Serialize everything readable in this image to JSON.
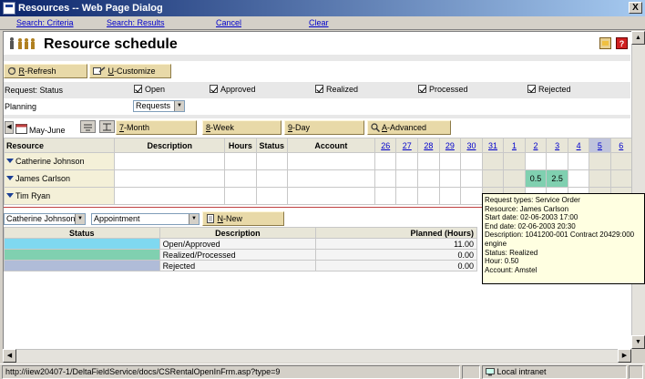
{
  "window": {
    "title": "Resources -- Web Page Dialog",
    "close_glyph": "X"
  },
  "nav": {
    "search_criteria": "Search: Criteria",
    "search_results": "Search: Results",
    "cancel": "Cancel",
    "clear": "Clear"
  },
  "header": {
    "title": "Resource schedule"
  },
  "toolbar": {
    "refresh_key": "R",
    "refresh_label": "-Refresh",
    "customize_key": "U",
    "customize_label": "-Customize"
  },
  "request": {
    "label": "Request: Status",
    "checks": [
      {
        "label": "Open",
        "checked": true
      },
      {
        "label": "Approved",
        "checked": true
      },
      {
        "label": "Realized",
        "checked": true
      },
      {
        "label": "Processed",
        "checked": true
      },
      {
        "label": "Rejected",
        "checked": true
      }
    ]
  },
  "planning": {
    "label": "Planning",
    "value": "Requests"
  },
  "period": {
    "range_label": "May-June",
    "month_key": "7",
    "month_label": "-Month",
    "week_key": "8",
    "week_label": "-Week",
    "day_key": "9",
    "day_label": "-Day",
    "advanced_key": "A",
    "advanced_label": "-Advanced"
  },
  "grid": {
    "headers": {
      "resource": "Resource",
      "description": "Description",
      "hours": "Hours",
      "status": "Status",
      "account": "Account"
    },
    "days": [
      "26",
      "27",
      "28",
      "29",
      "30",
      "31",
      "1",
      "2",
      "3",
      "4",
      "5",
      "6"
    ],
    "rows": [
      {
        "name": "Catherine Johnson"
      },
      {
        "name": "James Carlson",
        "cells": {
          "2": "0.5",
          "3": "2.5"
        }
      },
      {
        "name": "Tim Ryan"
      }
    ]
  },
  "filters": {
    "resource_value": "Catherine Johnson",
    "type_value": "Appointment",
    "new_key": "N",
    "new_label": "-New"
  },
  "legend": {
    "headers": {
      "status": "Status",
      "description": "Description",
      "planned": "Planned (Hours)"
    },
    "rows": [
      {
        "description": "Open/Approved",
        "planned": "11.00",
        "color": "#7fd8f0"
      },
      {
        "description": "Realized/Processed",
        "planned": "0.00",
        "color": "#80d0b0"
      },
      {
        "description": "Rejected",
        "planned": "0.00",
        "color": "#b0bcd8"
      }
    ]
  },
  "tooltip": {
    "lines": [
      "Request types: Service Order",
      "Resource: James Carlson",
      "Start date: 02-06-2003 17:00",
      "End date: 02-06-2003 20:30",
      "Description: 1041200-001 Contract 20429:000",
      "engine",
      "Status: Realized",
      "Hour: 0.50",
      "Account: Amstel"
    ]
  },
  "status": {
    "url": "http://iiew20407-1/DeltaFieldService/docs/CSRentalOpenInFrm.asp?type=9",
    "zone": "Local intranet"
  },
  "colors": {
    "title_bar": "#0a246a",
    "button_beige": "#e8d9a8",
    "green": "#80d0b0"
  }
}
